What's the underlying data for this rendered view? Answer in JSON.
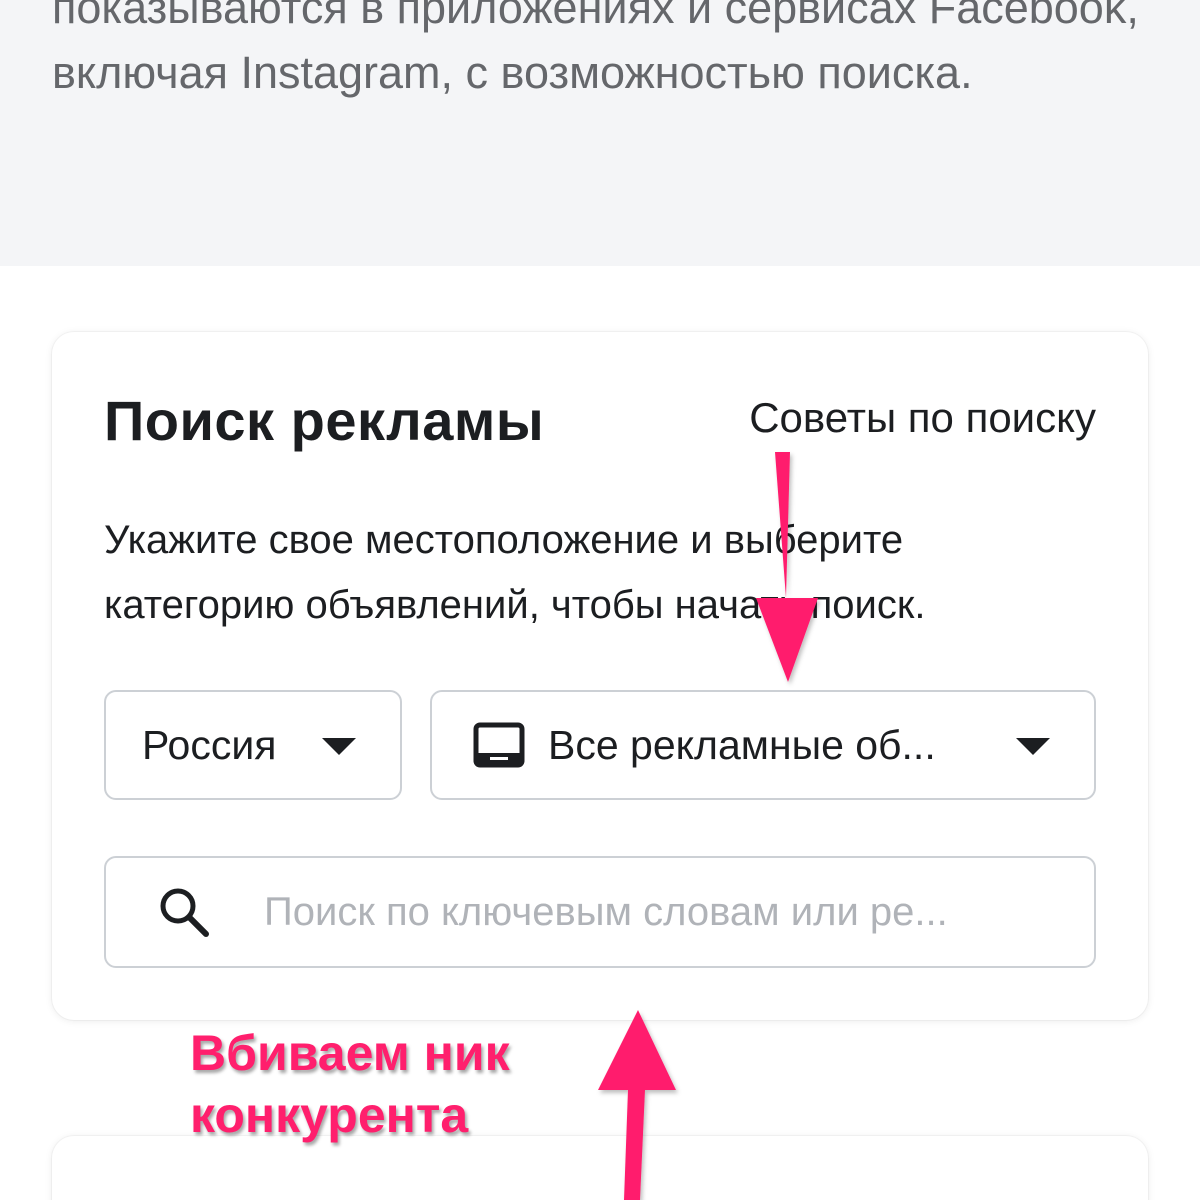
{
  "intro": {
    "text": "показываются в приложениях и сервисах Facebook, включая Instagram, с возможностью поиска."
  },
  "search_card": {
    "title": "Поиск рекламы",
    "tips_link": "Советы по поиску",
    "description": "Укажите свое местоположение и выберите категорию объявлений, чтобы начать поиск.",
    "country_select": {
      "value": "Россия"
    },
    "ad_type_select": {
      "value": "Все рекламные об...",
      "icon": "device-icon"
    },
    "search": {
      "value": "",
      "placeholder": "Поиск по ключевым словам или ре...",
      "icon": "search-icon"
    }
  },
  "annotation": {
    "line1": "Вбиваем ник",
    "line2": "конкурента",
    "color": "#ff1f6d"
  },
  "colors": {
    "header_background": "#f4f5f7",
    "text_primary": "#1c1e21",
    "text_secondary": "#65676b",
    "border": "#ccd0d5",
    "annotation_arrow": "#ff1f6d"
  }
}
